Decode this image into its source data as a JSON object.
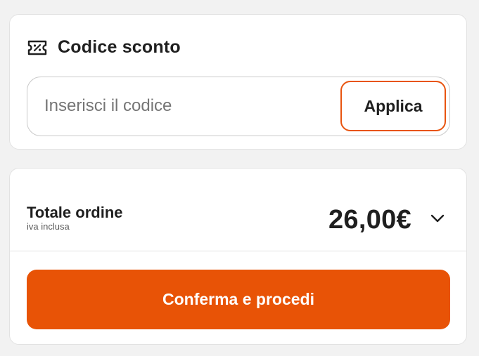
{
  "discount": {
    "icon": "coupon-percent-icon",
    "title": "Codice sconto",
    "input": {
      "value": "",
      "placeholder": "Inserisci il codice"
    },
    "apply_label": "Applica"
  },
  "order": {
    "total_label": "Totale ordine",
    "total_sublabel": "iva inclusa",
    "total_amount": "26,00€",
    "expand_icon": "chevron-down-icon",
    "confirm_label": "Conferma e procedi"
  },
  "colors": {
    "accent": "#e85306",
    "apply_border": "#e8540f",
    "text": "#1f1f1f",
    "background": "#f2f2f2"
  }
}
